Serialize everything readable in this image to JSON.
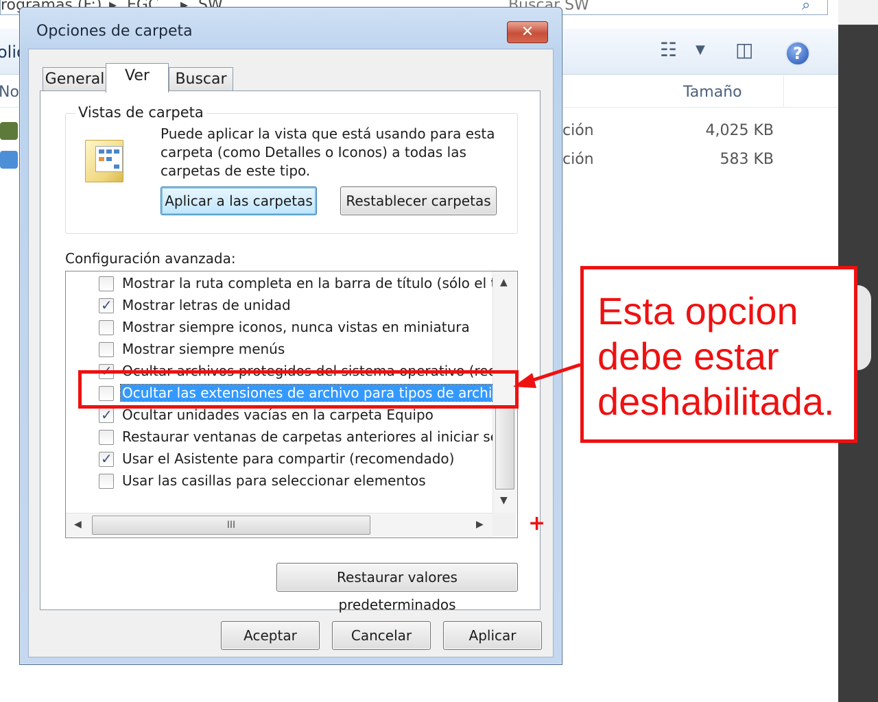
{
  "explorer": {
    "address_parts": [
      "rogramas (F:)",
      "▸",
      "EGC...",
      "▸",
      "SW"
    ],
    "search_placeholder": "Buscar SW",
    "toolbar_cut_text": "olio",
    "column_name_header": "No",
    "column_size_header": "Tamaño",
    "rows": [
      {
        "type": "ción",
        "size": "4,025 KB"
      },
      {
        "type": "ción",
        "size": "583 KB"
      }
    ],
    "icons": [
      "views-icon",
      "chevron-down-icon",
      "preview-pane-icon",
      "help-icon",
      "search-icon"
    ]
  },
  "dialog": {
    "title": "Opciones de carpeta",
    "close_label": "✕",
    "tabs": [
      {
        "label": "General",
        "active": false
      },
      {
        "label": "Ver",
        "active": true
      },
      {
        "label": "Buscar",
        "active": false
      }
    ],
    "views_group": {
      "label": "Vistas de carpeta",
      "description": "Puede aplicar la vista que está usando para esta carpeta (como Detalles o Iconos) a todas las carpetas de este tipo.",
      "apply_button": "Aplicar a las carpetas",
      "reset_button": "Restablecer carpetas"
    },
    "advanced_label": "Configuración avanzada:",
    "advanced_items": [
      {
        "label": "Mostrar la ruta completa en la barra de título (sólo el tema",
        "checked": false,
        "selected": false
      },
      {
        "label": "Mostrar letras de unidad",
        "checked": true,
        "selected": false
      },
      {
        "label": "Mostrar siempre iconos, nunca vistas en miniatura",
        "checked": false,
        "selected": false
      },
      {
        "label": "Mostrar siempre menús",
        "checked": false,
        "selected": false
      },
      {
        "label": "Ocultar archivos protegidos del sistema operativo (recome",
        "checked": true,
        "selected": false
      },
      {
        "label": "Ocultar las extensiones de archivo para tipos de archivo c",
        "checked": false,
        "selected": true
      },
      {
        "label": "Ocultar unidades vacías en la carpeta Equipo",
        "checked": true,
        "selected": false
      },
      {
        "label": "Restaurar ventanas de carpetas anteriores al iniciar sesió",
        "checked": false,
        "selected": false
      },
      {
        "label": "Usar el Asistente para compartir (recomendado)",
        "checked": true,
        "selected": false
      },
      {
        "label": "Usar las casillas para seleccionar elementos",
        "checked": false,
        "selected": false
      }
    ],
    "hscroll_grip": "III",
    "restore_defaults_button": "Restaurar valores predeterminados",
    "ok_button": "Aceptar",
    "cancel_button": "Cancelar",
    "apply_button": "Aplicar"
  },
  "annotation": {
    "note_text": "Esta opcion debe estar deshabilitada.",
    "plus": "+",
    "color": "#ee1111"
  },
  "colors": {
    "selection": "#3399ff",
    "annotation": "#ee1111",
    "close_button": "#c7503a"
  }
}
